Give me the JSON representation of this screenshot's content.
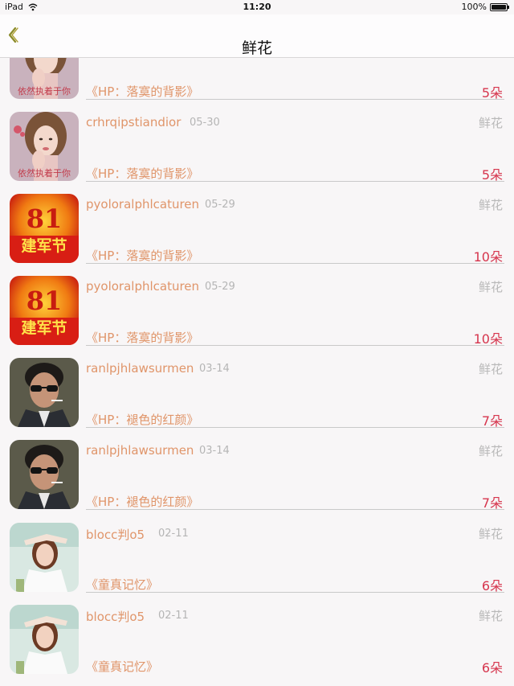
{
  "status_bar": {
    "device": "iPad",
    "time": "11:20",
    "battery": "100%"
  },
  "nav": {
    "title": "鲜花"
  },
  "rows": [
    {
      "username": "",
      "date": "",
      "gift_type": "",
      "book_title": "《HP：落寞的背影》",
      "count": "5朵",
      "avatar": "girl-hand-avatar"
    },
    {
      "username": "crhrqipstiandior",
      "date": "05-30",
      "gift_type": "鲜花",
      "book_title": "《HP：落寞的背影》",
      "count": "5朵",
      "avatar": "girl-hand-avatar"
    },
    {
      "username": "pyoloralphlcaturen",
      "date": "05-29",
      "gift_type": "鲜花",
      "book_title": "《HP：落寞的背影》",
      "count": "10朵",
      "avatar": "army-day-avatar"
    },
    {
      "username": "pyoloralphlcaturen",
      "date": "05-29",
      "gift_type": "鲜花",
      "book_title": "《HP：落寞的背影》",
      "count": "10朵",
      "avatar": "army-day-avatar"
    },
    {
      "username": "ranlpjhlawsurmen",
      "date": "03-14",
      "gift_type": "鲜花",
      "book_title": "《HP：褪色的红颜》",
      "count": "7朵",
      "avatar": "man-sunglasses-avatar"
    },
    {
      "username": "ranlpjhlawsurmen",
      "date": "03-14",
      "gift_type": "鲜花",
      "book_title": "《HP：褪色的红颜》",
      "count": "7朵",
      "avatar": "man-sunglasses-avatar"
    },
    {
      "username": "blocc判o5",
      "date": "02-11",
      "gift_type": "鲜花",
      "book_title": "《童真记忆》",
      "count": "6朵",
      "avatar": "woman-sun-avatar"
    },
    {
      "username": "blocc判o5",
      "date": "02-11",
      "gift_type": "鲜花",
      "book_title": "《童真记忆》",
      "count": "6朵",
      "avatar": "woman-sun-avatar"
    }
  ],
  "avatar_text": {
    "girl": "依然执着于你",
    "army": "建军节",
    "army_num": "81"
  },
  "colors": {
    "accent_text": "#e0956a",
    "count_red": "#d6354d",
    "muted": "#b5b5b5",
    "background": "#f8f6f7"
  }
}
